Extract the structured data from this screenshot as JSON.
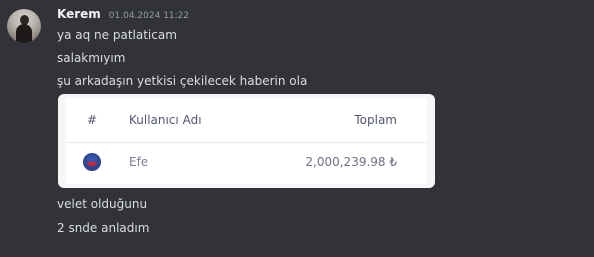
{
  "message": {
    "username": "Kerem",
    "timestamp": "01.04.2024 11:22",
    "lines": [
      "ya aq ne patlaticam",
      "salakmıyım",
      "şu arkadaşın yetkisi çekilecek haberin ola",
      "velet olduğunu",
      "2 snde anladım"
    ]
  },
  "embed": {
    "columns": {
      "number": "#",
      "username": "Kullanıcı Adı",
      "total": "Toplam"
    },
    "rows": [
      {
        "avatar_icon": "blue-monster-avatar-icon",
        "username": "Efe",
        "total": "2,000,239.98 ₺"
      }
    ]
  },
  "colors": {
    "background": "#313338",
    "username": "#f2f3f5",
    "message_text": "#dbdee1",
    "timestamp": "#949ba4",
    "embed_background": "#ffffff"
  }
}
